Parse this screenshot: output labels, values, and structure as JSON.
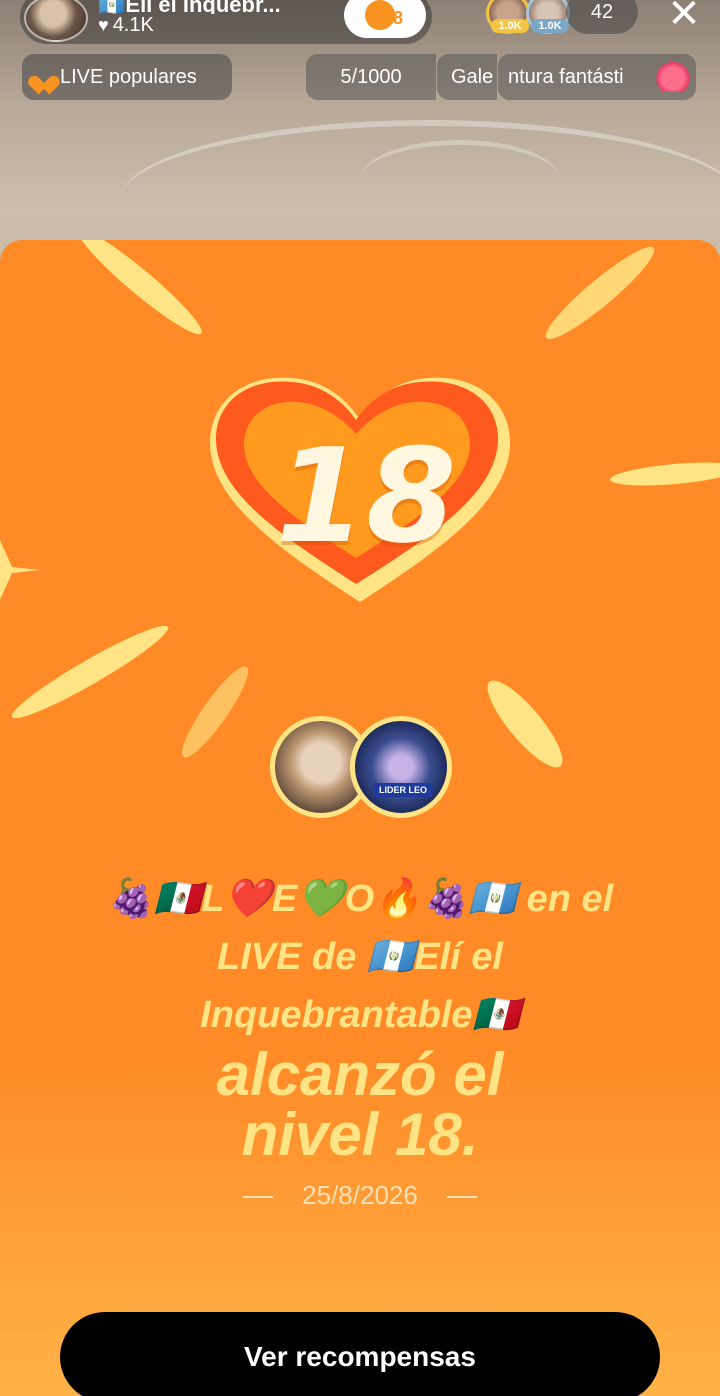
{
  "header": {
    "host_name": "🇬🇹Elí el Inquebr...",
    "likes": "4.1K",
    "level_badge": "18",
    "viewer_tags": [
      "1.0K",
      "1.0K"
    ],
    "viewer_count": "42",
    "close_icon": "close-icon"
  },
  "subheader": {
    "popular_label": "LIVE populares",
    "rank": "5/1000",
    "gallery_label": "Gale",
    "adventure_label": "ntura fantásti"
  },
  "card": {
    "level": "18",
    "guest_label": "LIDER LEO",
    "message_line1": "🍇🇲🇽L❤️E💚O🔥🍇🇬🇹 en el",
    "message_line2": "LIVE de 🇬🇹Elí el",
    "message_line3": "Inquebrantable🇲🇽",
    "achieved_line1": "alcanzó el",
    "achieved_line2": "nivel 18.",
    "date": "25/8/2026",
    "button_label": "Ver recompensas"
  },
  "colors": {
    "card_orange": "#ff8a26",
    "accent_yellow": "#ffe486",
    "button_black": "#000000"
  }
}
